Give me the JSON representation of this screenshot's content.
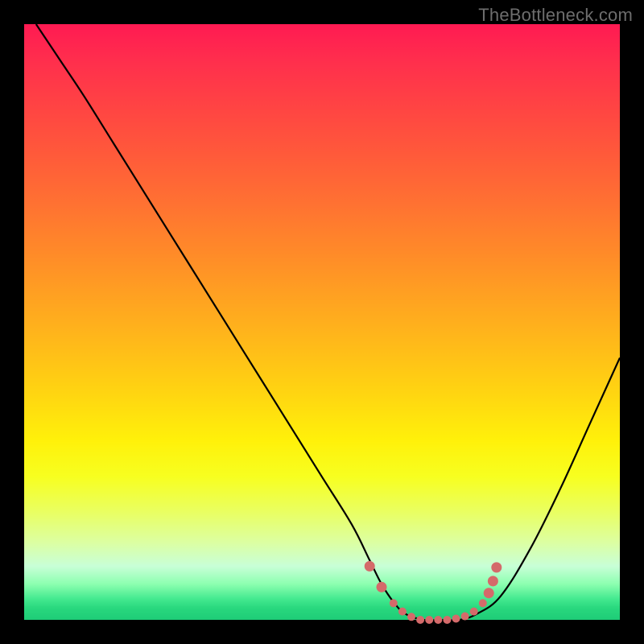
{
  "watermark": "TheBottleneck.com",
  "chart_data": {
    "type": "line",
    "title": "",
    "xlabel": "",
    "ylabel": "",
    "xlim": [
      0,
      100
    ],
    "ylim": [
      0,
      100
    ],
    "series": [
      {
        "name": "bottleneck-curve",
        "x": [
          2,
          6,
          10,
          15,
          20,
          25,
          30,
          35,
          40,
          45,
          50,
          55,
          58,
          60,
          62,
          64,
          67,
          70,
          73,
          76,
          80,
          85,
          90,
          95,
          100
        ],
        "values": [
          100,
          94,
          88,
          80,
          72,
          64,
          56,
          48,
          40,
          32,
          24,
          16,
          10,
          6,
          3,
          1,
          0,
          0,
          0,
          1,
          4,
          12,
          22,
          33,
          44
        ]
      }
    ],
    "markers": {
      "name": "highlight-points",
      "color": "#d46a6a",
      "x": [
        58,
        60,
        62,
        63.5,
        65,
        66.5,
        68,
        69.5,
        71,
        72.5,
        74,
        75.5,
        77,
        78,
        78.7,
        79.3
      ],
      "values": [
        9,
        5.5,
        2.8,
        1.4,
        0.5,
        0,
        0,
        0,
        0,
        0.2,
        0.6,
        1.4,
        2.8,
        4.5,
        6.5,
        8.8
      ]
    }
  },
  "colors": {
    "curve": "#000000",
    "marker": "#d46a6a",
    "gradient_top": "#ff1a52",
    "gradient_bottom": "#1ecc77"
  }
}
